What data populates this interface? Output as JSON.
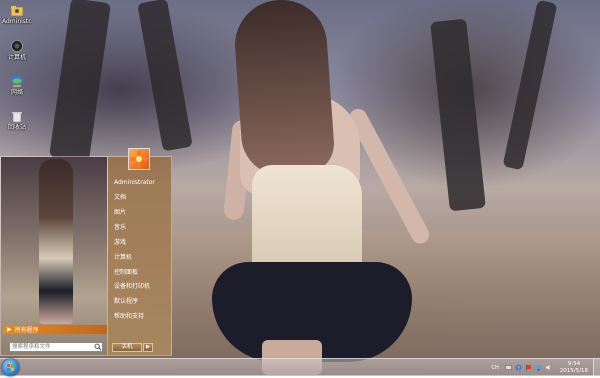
{
  "desktop": {
    "icons": [
      {
        "label": "Administr...",
        "icon": "user-folder-icon"
      },
      {
        "label": "计算机",
        "icon": "computer-icon"
      },
      {
        "label": "网络",
        "icon": "network-icon"
      },
      {
        "label": "回收站",
        "icon": "recycle-bin-icon"
      }
    ]
  },
  "start_menu": {
    "all_programs": "所有程序",
    "search_placeholder": "搜索程序和文件",
    "user_name": "Administrator",
    "right_items": [
      "文档",
      "图片",
      "音乐",
      "游戏",
      "计算机",
      "控制面板",
      "设备和打印机",
      "默认程序",
      "帮助和支持"
    ],
    "shutdown_label": "关机",
    "accent_color": "#e98a1c"
  },
  "taskbar": {
    "language": "CH",
    "time": "9:54",
    "date": "2015/5/18"
  }
}
